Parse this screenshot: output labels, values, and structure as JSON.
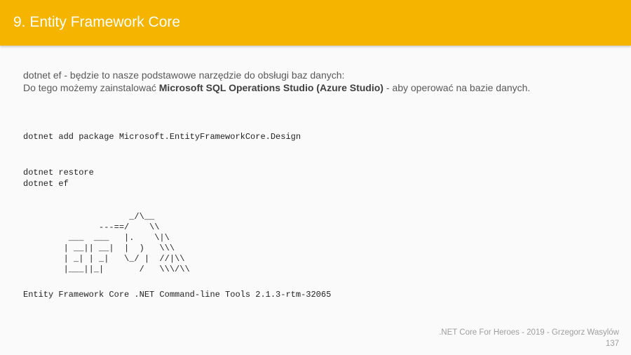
{
  "slide": {
    "title": "9. Entity Framework Core",
    "body": {
      "line1": "dotnet ef - będzie to nasze podstawowe narzędzie do obsługi baz danych:",
      "line2_prefix": "Do tego możemy zainstalować ",
      "line2_bold": "Microsoft SQL Operations Studio (Azure Studio)",
      "line2_suffix": " - aby operować na bazie danych."
    },
    "code": {
      "add_package": "dotnet add package Microsoft.EntityFrameworkCore.Design",
      "restore_lines": "dotnet restore\ndotnet ef",
      "ascii_logo": "                     _/\\__\n               ---==/    \\\\\n         ___  ___   |.    \\|\\\n        | __|| __|  |  )   \\\\\\\n        | _| | _|   \\_/ |  //|\\\\\n        |___||_|       /   \\\\\\/\\\\",
      "version": "Entity Framework Core .NET Command-line Tools 2.1.3-rtm-32065"
    },
    "footer": {
      "credit": ".NET Core For Heroes - 2019 - Grzegorz Wasylów",
      "page_number": "137"
    }
  },
  "colors": {
    "title_bar": "#f4b400",
    "title_text": "#ffffff",
    "body_text": "#595959",
    "footer_text": "#9e9e9e"
  }
}
